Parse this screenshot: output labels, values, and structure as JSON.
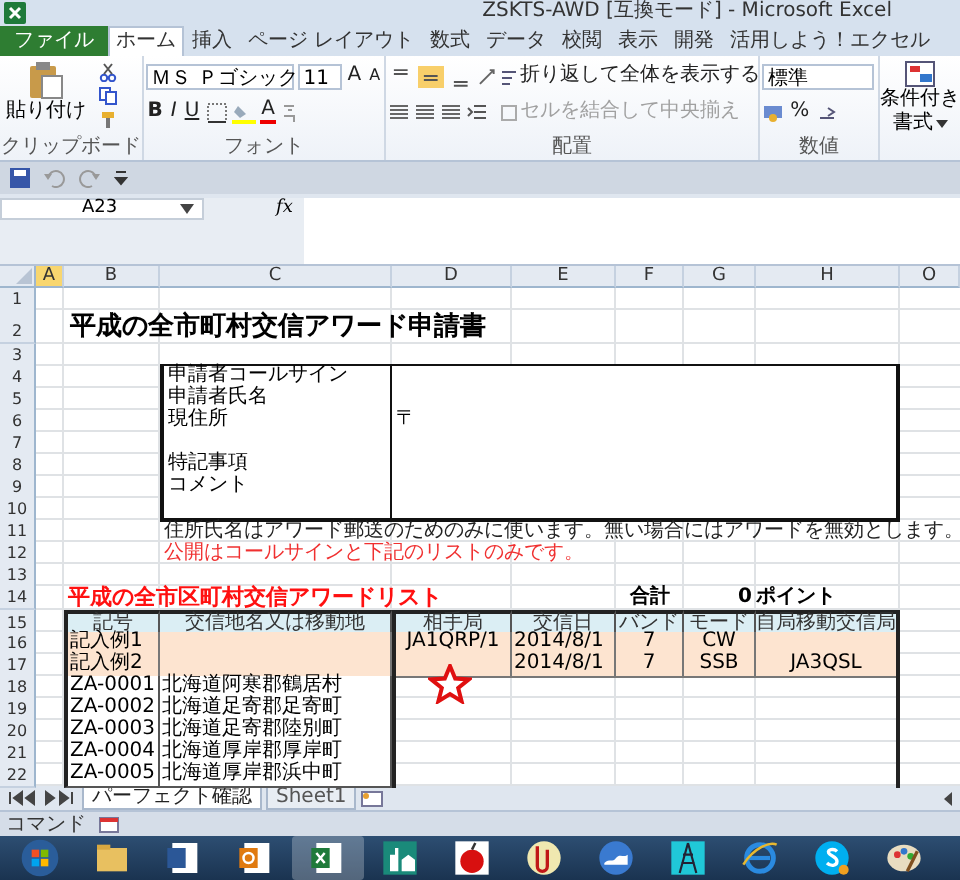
{
  "window": {
    "title": "ZSKTS-AWD  [互換モード] - Microsoft Excel"
  },
  "ribbon": {
    "tabs": [
      {
        "label": "ファイル",
        "kind": "file",
        "selected": false
      },
      {
        "label": "ホーム",
        "kind": "tab",
        "selected": true
      },
      {
        "label": "挿入",
        "kind": "tab",
        "selected": false
      },
      {
        "label": "ページ レイアウト",
        "kind": "tab",
        "selected": false
      },
      {
        "label": "数式",
        "kind": "tab",
        "selected": false
      },
      {
        "label": "データ",
        "kind": "tab",
        "selected": false
      },
      {
        "label": "校閲",
        "kind": "tab",
        "selected": false
      },
      {
        "label": "表示",
        "kind": "tab",
        "selected": false
      },
      {
        "label": "開発",
        "kind": "tab",
        "selected": false
      },
      {
        "label": "活用しよう！エクセル",
        "kind": "tab",
        "selected": false
      }
    ],
    "paste_label": "貼り付け",
    "font_name": "ＭＳ Ｐゴシック",
    "font_size": "11",
    "format_buttons": [
      "B",
      "I",
      "U"
    ],
    "font_color_label": "A",
    "grow_label": "A",
    "shrink_label": "A",
    "vertical_align": [
      {
        "selected": false
      },
      {
        "selected": true
      },
      {
        "selected": false
      }
    ],
    "wrap_text": "折り返して全体を表示する",
    "merge_center": {
      "label": "セルを結合して中央揃え",
      "disabled": true
    },
    "number_format": "標準",
    "percent": "%",
    "conditional_format": "条件付き",
    "format_label": "書式",
    "groups": [
      "クリップボード",
      "フォント",
      "配置",
      "数値"
    ]
  },
  "formula_bar": {
    "name_box": "A23",
    "function_label": "fx"
  },
  "sheet": {
    "columns": [
      {
        "label": "A",
        "selected": true
      },
      {
        "label": "B",
        "selected": false
      },
      {
        "label": "C",
        "selected": false
      },
      {
        "label": "D",
        "selected": false
      },
      {
        "label": "E",
        "selected": false
      },
      {
        "label": "F",
        "selected": false
      },
      {
        "label": "G",
        "selected": false
      },
      {
        "label": "H",
        "selected": false
      },
      {
        "label": "O",
        "selected": false
      }
    ],
    "row_numbers": [
      "1",
      "2",
      "3",
      "4",
      "5",
      "6",
      "7",
      "8",
      "9",
      "10",
      "11",
      "12",
      "13",
      "14",
      "15",
      "16",
      "17",
      "18",
      "19",
      "20",
      "21",
      "22"
    ]
  },
  "form": {
    "title": "平成の全市町村交信アワード申請書",
    "fields": [
      {
        "label": "申請者コールサイン",
        "kind": "line"
      },
      {
        "label": "申請者氏名",
        "kind": "line"
      },
      {
        "label": "現住所",
        "kind": "double",
        "value": "〒"
      },
      {
        "label": "特記事項",
        "kind": "line"
      },
      {
        "label": "コメント",
        "kind": "double"
      }
    ],
    "note": "住所氏名はアワード郵送のためのみに使います。無い場合にはアワードを無効とします。",
    "public_note": "公開はコールサインと下記のリストのみです。"
  },
  "list": {
    "title": "平成の全市区町村交信アワードリスト",
    "total_label": "合計",
    "total_value": "0",
    "total_unit": "ポイント",
    "columns": [
      "記号",
      "交信地名又は移動地",
      "相手局",
      "交信日",
      "バンド",
      "モード",
      "自局移動交信局"
    ],
    "rows": [
      {
        "kind": "example",
        "code": "記入例1",
        "partner": "JA1QRP/1",
        "date": "2014/8/1",
        "band": "7",
        "mode": "CW"
      },
      {
        "kind": "example",
        "code": "記入例2",
        "date": "2014/8/1",
        "band": "7",
        "mode": "SSB",
        "own_station": "JA3QSL"
      },
      {
        "kind": "entry",
        "code": "ZA-0001",
        "place": "北海道阿寒郡鶴居村"
      },
      {
        "kind": "entry",
        "code": "ZA-0002",
        "place": "北海道足寄郡足寄町"
      },
      {
        "kind": "entry",
        "code": "ZA-0003",
        "place": "北海道足寄郡陸別町"
      },
      {
        "kind": "entry",
        "code": "ZA-0004",
        "place": "北海道厚岸郡厚岸町"
      },
      {
        "kind": "entry",
        "code": "ZA-0005",
        "place": "北海道厚岸郡浜中町"
      }
    ]
  },
  "sheet_tabs": [
    {
      "label": "パーフェクト確認",
      "selected": true
    },
    {
      "label": "Sheet1",
      "selected": false
    }
  ],
  "status_bar": {
    "mode": "コマンド"
  }
}
